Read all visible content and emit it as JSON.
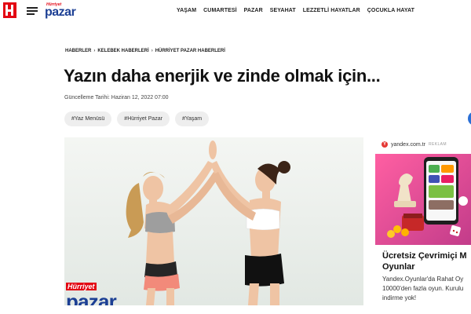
{
  "header": {
    "brand_top": "Hürriyet",
    "brand_main": "pazar",
    "nav": [
      "YAŞAM",
      "CUMARTESİ",
      "PAZAR",
      "SEYAHAT",
      "LEZZETLİ HAYATLAR",
      "ÇOCUKLA HAYAT"
    ]
  },
  "breadcrumb": [
    "HABERLER",
    "KELEBEK HABERLERİ",
    "HÜRRİYET PAZAR HABERLERİ"
  ],
  "article": {
    "title": "Yazın daha enerjik ve zinde olmak için...",
    "updated": "Güncelleme Tarihi: Haziran 12, 2022 07:00",
    "tags": [
      "#Yaz Menüsü",
      "#Hürriyet Pazar",
      "#Yaşam"
    ],
    "image_brand_top": "Hürriyet",
    "image_brand_main": "pazar"
  },
  "ad": {
    "domain": "yandex.com.tr",
    "label": "REKLAM",
    "title_line1": "Ücretsiz Çevrimiçi M",
    "title_line2": "Oyunlar",
    "desc_line1": "Yandex.Oyunlar'da Rahat Oy",
    "desc_line2": "10000'den fazla oyun. Kurulu",
    "desc_line3": "indirme yok!"
  },
  "colors": {
    "brand_red": "#e30613",
    "brand_blue": "#1c3f94",
    "tag_bg": "#eeeeee",
    "ad_bg": "#e64a8a"
  }
}
